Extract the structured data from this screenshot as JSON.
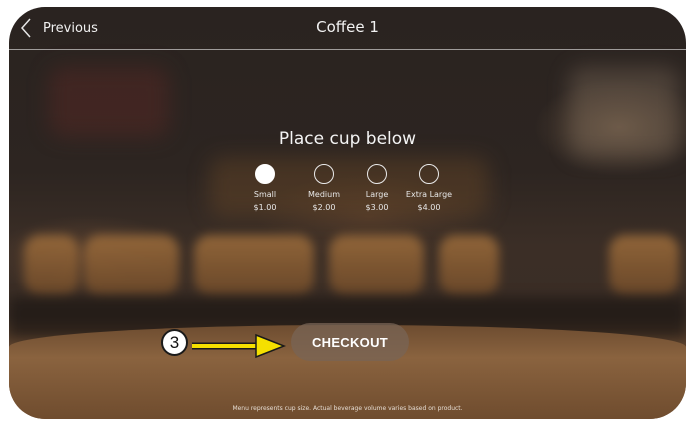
{
  "header": {
    "back_label": "Previous",
    "title": "Coffee 1"
  },
  "main": {
    "prompt": "Place cup below",
    "sizes": [
      {
        "name": "Small",
        "price": "$1.00",
        "selected": true
      },
      {
        "name": "Medium",
        "price": "$2.00",
        "selected": false
      },
      {
        "name": "Large",
        "price": "$3.00",
        "selected": false
      },
      {
        "name": "Extra Large",
        "price": "$4.00",
        "selected": false
      }
    ],
    "checkout_label": "CHECKOUT"
  },
  "annotation": {
    "step_number": "3",
    "arrow_color": "#f5e000"
  },
  "footer": {
    "note": "Menu represents cup size. Actual beverage volume varies based on product."
  },
  "colors": {
    "text": "#ffffff",
    "button_bg": "#786455"
  },
  "icons": {
    "back": "chevron-left-icon"
  }
}
